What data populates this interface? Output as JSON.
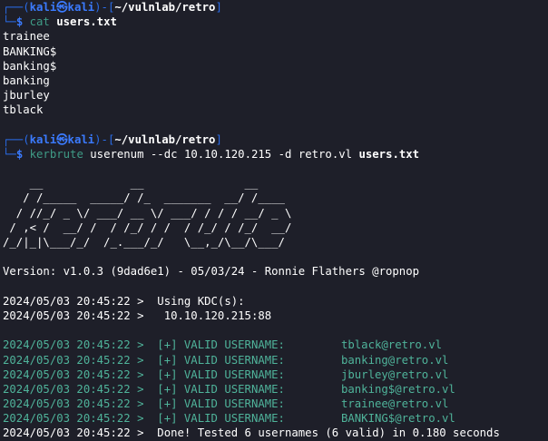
{
  "prompt": {
    "corner_top": "┌──(",
    "user": "kali㉿kali",
    "bracket_mid": ")-[",
    "path": "~/vulnlab/retro",
    "bracket_close": "]",
    "corner_bottom": "└─",
    "dollar": "$ "
  },
  "cmd1": {
    "command": "cat",
    "arg": "users.txt"
  },
  "users_output": [
    "trainee",
    "BANKING$",
    "banking$",
    "banking",
    "jburley",
    "tblack"
  ],
  "cmd2": {
    "command": "kerbrute",
    "sub": "userenum",
    "flag_dc": "--dc",
    "ip": "10.10.120.215",
    "flag_d": "-d",
    "domain": "retro.vl",
    "file": "users.txt"
  },
  "banner": [
    "    __             __               __     ",
    "   / /_____  _____/ /_  _______  __/ /____ ",
    "  / //_/ _ \\/ ___/ __ \\/ ___/ / / / __/ _ \\",
    " / ,< /  __/ /  / /_/ / /  / /_/ / /_/  __/",
    "/_/|_|\\___/_/  /_.___/_/   \\__,_/\\__/\\___/ "
  ],
  "version_line": "Version: v1.0.3 (9dad6e1) - 05/03/24 - Ronnie Flathers @ropnop",
  "kdc": {
    "line1_ts": "2024/05/03 20:45:22 >",
    "line1_text": "  Using KDC(s):",
    "line2_ts": "2024/05/03 20:45:22 >",
    "line2_text": "   10.10.120.215:88"
  },
  "valid_results": [
    {
      "ts": "2024/05/03 20:45:22 >",
      "label": "  [+] VALID USERNAME:",
      "user": "tblack@retro.vl"
    },
    {
      "ts": "2024/05/03 20:45:22 >",
      "label": "  [+] VALID USERNAME:",
      "user": "banking@retro.vl"
    },
    {
      "ts": "2024/05/03 20:45:22 >",
      "label": "  [+] VALID USERNAME:",
      "user": "jburley@retro.vl"
    },
    {
      "ts": "2024/05/03 20:45:22 >",
      "label": "  [+] VALID USERNAME:",
      "user": "banking$@retro.vl"
    },
    {
      "ts": "2024/05/03 20:45:22 >",
      "label": "  [+] VALID USERNAME:",
      "user": "trainee@retro.vl"
    },
    {
      "ts": "2024/05/03 20:45:22 >",
      "label": "  [+] VALID USERNAME:",
      "user": "BANKING$@retro.vl"
    }
  ],
  "done_line": {
    "ts": "2024/05/03 20:45:22 >",
    "text": "  Done! Tested 6 usernames (6 valid) in 0.180 seconds"
  },
  "colors": {
    "background": "#1e1f29",
    "prompt_blue": "#3b7bff",
    "command_green": "#3f9b86",
    "valid_green": "#4fb39a"
  }
}
